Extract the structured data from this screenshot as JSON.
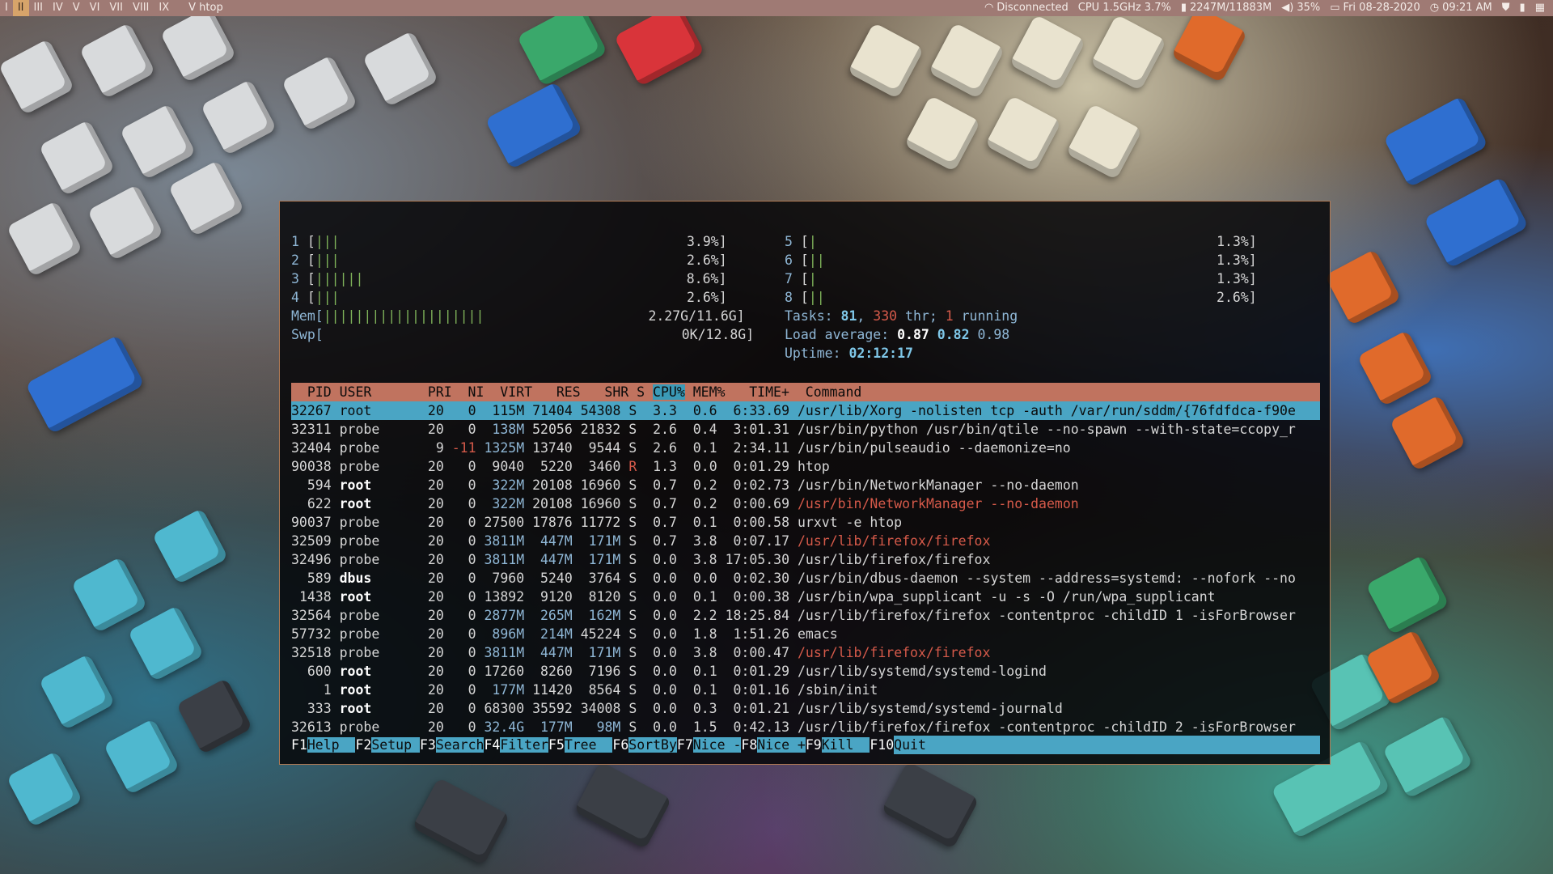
{
  "topbar": {
    "workspaces": [
      "I",
      "II",
      "III",
      "IV",
      "V",
      "VI",
      "VII",
      "VIII",
      "IX"
    ],
    "active_workspace": "II",
    "window_title": "V htop",
    "network": "Disconnected",
    "cpu": "CPU 1.5GHz 3.7%",
    "memory": "2247M/11883M",
    "volume": "35%",
    "date": "Fri 08-28-2020",
    "time": "09:21 AM"
  },
  "htop": {
    "cpus_left": [
      {
        "id": "1",
        "bar": "|||",
        "pct": "3.9%]"
      },
      {
        "id": "2",
        "bar": "|||",
        "pct": "2.6%]"
      },
      {
        "id": "3",
        "bar": "||||||",
        "pct": "8.6%]"
      },
      {
        "id": "4",
        "bar": "|||",
        "pct": "2.6%]"
      }
    ],
    "cpus_right": [
      {
        "id": "5",
        "bar": "|",
        "pct": "1.3%]"
      },
      {
        "id": "6",
        "bar": "||",
        "pct": "1.3%]"
      },
      {
        "id": "7",
        "bar": "|",
        "pct": "1.3%]"
      },
      {
        "id": "8",
        "bar": "||",
        "pct": "2.6%]"
      }
    ],
    "mem": {
      "label": "Mem[",
      "bar": "||||||||||||||||||||",
      "value": "2.27G/11.6G]"
    },
    "swp": {
      "label": "Swp[",
      "bar": "",
      "value": "0K/12.8G]"
    },
    "tasks": {
      "label": "Tasks: ",
      "count": "81",
      "thr": "330",
      "thr_label": " thr; ",
      "running": "1",
      "running_label": " running"
    },
    "load": {
      "label": "Load average: ",
      "l1": "0.87",
      "l5": "0.82",
      "l15": "0.98"
    },
    "uptime": {
      "label": "Uptime: ",
      "value": "02:12:17"
    },
    "header": {
      "pre": "  PID USER       PRI  NI  VIRT   RES   SHR S ",
      "sort": "CPU%",
      "post": " MEM%   TIME+  Command"
    },
    "processes": [
      {
        "pid": "32267",
        "user": "root",
        "pri": "20",
        "ni": "0",
        "virt": "115M",
        "res": "71404",
        "shr": "54308",
        "s": "S",
        "cpu": "3.3",
        "mem": "0.6",
        "time": "6:33.69",
        "cmd": "/usr/lib/Xorg -nolisten tcp -auth /var/run/sddm/{76fdfdca-f90e"
      },
      {
        "pid": "32311",
        "user": "probe",
        "pri": "20",
        "ni": "0",
        "virt": "138M",
        "res": "52056",
        "shr": "21832",
        "s": "S",
        "cpu": "2.6",
        "mem": "0.4",
        "time": "3:01.31",
        "cmd": "/usr/bin/python /usr/bin/qtile --no-spawn --with-state=ccopy_r"
      },
      {
        "pid": "32404",
        "user": "probe",
        "pri": "9",
        "ni": "-11",
        "virt": "1325M",
        "res": "13740",
        "shr": "9544",
        "s": "S",
        "cpu": "2.6",
        "mem": "0.1",
        "time": "2:34.11",
        "cmd": "/usr/bin/pulseaudio --daemonize=no"
      },
      {
        "pid": "90038",
        "user": "probe",
        "pri": "20",
        "ni": "0",
        "virt": "9040",
        "res": "5220",
        "shr": "3460",
        "s": "R",
        "cpu": "1.3",
        "mem": "0.0",
        "time": "0:01.29",
        "cmd": "htop"
      },
      {
        "pid": "594",
        "user": "root",
        "pri": "20",
        "ni": "0",
        "virt": "322M",
        "res": "20108",
        "shr": "16960",
        "s": "S",
        "cpu": "0.7",
        "mem": "0.2",
        "time": "0:02.73",
        "cmd": "/usr/bin/NetworkManager --no-daemon"
      },
      {
        "pid": "622",
        "user": "root",
        "pri": "20",
        "ni": "0",
        "virt": "322M",
        "res": "20108",
        "shr": "16960",
        "s": "S",
        "cpu": "0.7",
        "mem": "0.2",
        "time": "0:00.69",
        "cmd": "/usr/bin/NetworkManager --no-daemon"
      },
      {
        "pid": "90037",
        "user": "probe",
        "pri": "20",
        "ni": "0",
        "virt": "27500",
        "res": "17876",
        "shr": "11772",
        "s": "S",
        "cpu": "0.7",
        "mem": "0.1",
        "time": "0:00.58",
        "cmd": "urxvt -e htop"
      },
      {
        "pid": "32509",
        "user": "probe",
        "pri": "20",
        "ni": "0",
        "virt": "3811M",
        "res": "447M",
        "shr": "171M",
        "s": "S",
        "cpu": "0.7",
        "mem": "3.8",
        "time": "0:07.17",
        "cmd": "/usr/lib/firefox/firefox"
      },
      {
        "pid": "32496",
        "user": "probe",
        "pri": "20",
        "ni": "0",
        "virt": "3811M",
        "res": "447M",
        "shr": "171M",
        "s": "S",
        "cpu": "0.0",
        "mem": "3.8",
        "time": "17:05.30",
        "cmd": "/usr/lib/firefox/firefox"
      },
      {
        "pid": "589",
        "user": "dbus",
        "pri": "20",
        "ni": "0",
        "virt": "7960",
        "res": "5240",
        "shr": "3764",
        "s": "S",
        "cpu": "0.0",
        "mem": "0.0",
        "time": "0:02.30",
        "cmd": "/usr/bin/dbus-daemon --system --address=systemd: --nofork --no"
      },
      {
        "pid": "1438",
        "user": "root",
        "pri": "20",
        "ni": "0",
        "virt": "13892",
        "res": "9120",
        "shr": "8120",
        "s": "S",
        "cpu": "0.0",
        "mem": "0.1",
        "time": "0:00.38",
        "cmd": "/usr/bin/wpa_supplicant -u -s -O /run/wpa_supplicant"
      },
      {
        "pid": "32564",
        "user": "probe",
        "pri": "20",
        "ni": "0",
        "virt": "2877M",
        "res": "265M",
        "shr": "162M",
        "s": "S",
        "cpu": "0.0",
        "mem": "2.2",
        "time": "18:25.84",
        "cmd": "/usr/lib/firefox/firefox -contentproc -childID 1 -isForBrowser"
      },
      {
        "pid": "57732",
        "user": "probe",
        "pri": "20",
        "ni": "0",
        "virt": "896M",
        "res": "214M",
        "shr": "45224",
        "s": "S",
        "cpu": "0.0",
        "mem": "1.8",
        "time": "1:51.26",
        "cmd": "emacs"
      },
      {
        "pid": "32518",
        "user": "probe",
        "pri": "20",
        "ni": "0",
        "virt": "3811M",
        "res": "447M",
        "shr": "171M",
        "s": "S",
        "cpu": "0.0",
        "mem": "3.8",
        "time": "0:00.47",
        "cmd": "/usr/lib/firefox/firefox"
      },
      {
        "pid": "600",
        "user": "root",
        "pri": "20",
        "ni": "0",
        "virt": "17260",
        "res": "8260",
        "shr": "7196",
        "s": "S",
        "cpu": "0.0",
        "mem": "0.1",
        "time": "0:01.29",
        "cmd": "/usr/lib/systemd/systemd-logind"
      },
      {
        "pid": "1",
        "user": "root",
        "pri": "20",
        "ni": "0",
        "virt": "177M",
        "res": "11420",
        "shr": "8564",
        "s": "S",
        "cpu": "0.0",
        "mem": "0.1",
        "time": "0:01.16",
        "cmd": "/sbin/init"
      },
      {
        "pid": "333",
        "user": "root",
        "pri": "20",
        "ni": "0",
        "virt": "68300",
        "res": "35592",
        "shr": "34008",
        "s": "S",
        "cpu": "0.0",
        "mem": "0.3",
        "time": "0:01.21",
        "cmd": "/usr/lib/systemd/systemd-journald"
      },
      {
        "pid": "32613",
        "user": "probe",
        "pri": "20",
        "ni": "0",
        "virt": "32.4G",
        "res": "177M",
        "shr": "98M",
        "s": "S",
        "cpu": "0.0",
        "mem": "1.5",
        "time": "0:42.13",
        "cmd": "/usr/lib/firefox/firefox -contentproc -childID 2 -isForBrowser"
      }
    ],
    "footer": [
      {
        "key": "F1",
        "label": "Help  "
      },
      {
        "key": "F2",
        "label": "Setup "
      },
      {
        "key": "F3",
        "label": "Search"
      },
      {
        "key": "F4",
        "label": "Filter"
      },
      {
        "key": "F5",
        "label": "Tree  "
      },
      {
        "key": "F6",
        "label": "SortBy"
      },
      {
        "key": "F7",
        "label": "Nice -"
      },
      {
        "key": "F8",
        "label": "Nice +"
      },
      {
        "key": "F9",
        "label": "Kill  "
      },
      {
        "key": "F10",
        "label": "Quit"
      }
    ]
  }
}
